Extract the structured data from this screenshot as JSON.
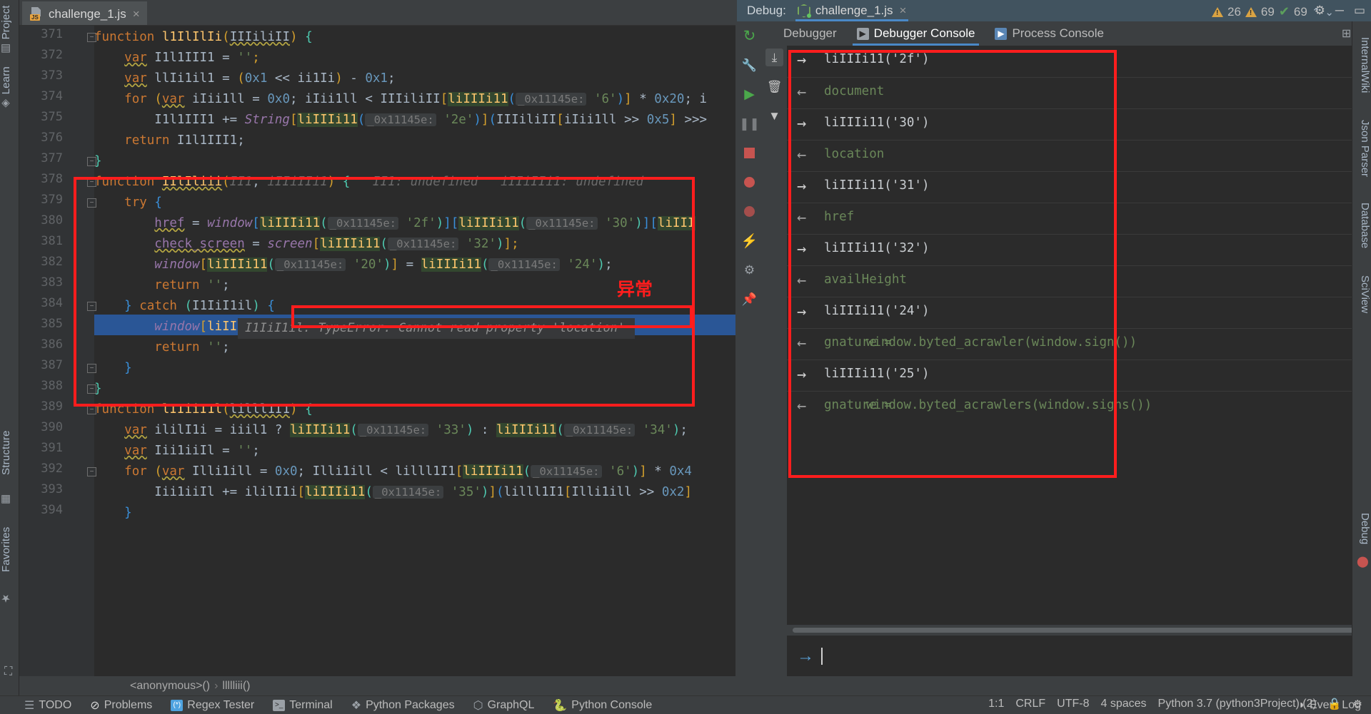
{
  "window": {
    "editor_tab": {
      "label": "challenge_1.js",
      "icon": "js-file-icon",
      "close": "×"
    },
    "debug_title": "Debug:",
    "debug_session_tab": "challenge_1.js",
    "debug_close": "×",
    "settings_icon": "gear-icon",
    "minimize_icon": "–",
    "hide_icon": "—"
  },
  "left_strip": [
    {
      "label": "Project",
      "icon": "project-icon"
    },
    {
      "label": "Learn",
      "icon": "learn-icon"
    },
    {
      "label": "Structure",
      "icon": "structure-icon"
    },
    {
      "label": "Favorites",
      "icon": "star-icon"
    }
  ],
  "right_strip": [
    {
      "label": "InternalWiki",
      "icon": "wiki-icon"
    },
    {
      "label": "Json Parser",
      "icon": "json-icon"
    },
    {
      "label": "Database",
      "icon": "database-icon"
    },
    {
      "label": "SciView",
      "icon": "sciview-icon"
    },
    {
      "label": "Debug",
      "icon": "debug-icon"
    }
  ],
  "inspection": {
    "warnings_major": "26",
    "warnings_minor": "69",
    "checks": "69",
    "up_icon": "chevron-up-icon",
    "down_icon": "chevron-down-icon"
  },
  "editor": {
    "first_line": 371,
    "current_exec_line": 385,
    "lines": [
      {
        "n": 371,
        "html": "<span class=\"kw\">function</span> <span class=\"fn\">l1IlIlIi</span><span class=\"brk1\">(</span><span class=\"wavy\">IIIiliII</span><span class=\"brk1\">)</span> <span class=\"brk3\">{</span>"
      },
      {
        "n": 372,
        "html": "    <span class=\"kw wavy\">var</span> I1l1III1 = <span class=\"str\">''</span><span class=\"brk1\">;</span>"
      },
      {
        "n": 373,
        "html": "    <span class=\"kw wavy\">var</span> llIi1il1 = <span class=\"brk1\">(</span><span class=\"num\">0x1</span> &lt;&lt; ii1Ii<span class=\"brk1\">)</span> - <span class=\"num\">0x1</span>;"
      },
      {
        "n": 374,
        "html": "    <span class=\"kw\">for</span> <span class=\"brk1\">(</span><span class=\"kw wavy\">var</span> iIii1ll = <span class=\"num\">0x0</span>; iIii1ll &lt; IIIiliII<span class=\"brk1\">[</span><span class=\"hl\"><span class=\"fn\">liIIIi11</span></span><span class=\"brk2\">(</span><span class=\"inlay\">_0x11145e:</span> <span class=\"str\">'6'</span><span class=\"brk2\">)</span><span class=\"brk1\">]</span> * <span class=\"num\">0x20</span>; i"
      },
      {
        "n": 375,
        "html": "        I1l1III1 += <span class=\"italic-pur\">String</span><span class=\"brk1\">[</span><span class=\"hl\"><span class=\"fn\">liIIIi11</span></span><span class=\"brk2\">(</span><span class=\"inlay\">_0x11145e:</span> <span class=\"str\">'2e'</span><span class=\"brk2\">)</span><span class=\"brk1\">]</span><span class=\"brk2\">(</span>IIIiliII<span class=\"brk1\">[</span>iIii1ll &gt;&gt; <span class=\"num\">0x5</span><span class=\"brk1\">]</span> &gt;&gt;&gt;"
      },
      {
        "n": 376,
        "html": "    <span class=\"kw\">return</span> I1l1III1;"
      },
      {
        "n": 377,
        "html": "<span class=\"brk3\">}</span>"
      },
      {
        "n": 378,
        "html": "<span class=\"kw\">function</span> <span class=\"fn wavy\">IIlIliii</span><span class=\"brk1\">(</span><span class=\"hint\">II1</span>, <span class=\"hint\">iIIiIIi1</span><span class=\"brk1\">)</span> <span class=\"brk3\">{</span>   <span class=\"hint\">II1: undefined   iIIiIIi1: undefined</span>"
      },
      {
        "n": 379,
        "html": "    <span class=\"kw\">try</span> <span class=\"brk2\">{</span>"
      },
      {
        "n": 380,
        "html": "        <span class=\"fld wavy\">href</span> = <span class=\"italic-pur\">window</span><span class=\"brk2\">[</span><span class=\"hl\"><span class=\"fn\">liIIIi11</span></span><span class=\"brk3\">(</span><span class=\"inlay\">_0x11145e:</span> <span class=\"str\">'2f'</span><span class=\"brk3\">)</span><span class=\"brk2\">]</span><span class=\"brk2\">[</span><span class=\"hl\"><span class=\"fn\">liIIIi11</span></span><span class=\"brk3\">(</span><span class=\"inlay\">_0x11145e:</span> <span class=\"str\">'30'</span><span class=\"brk3\">)</span><span class=\"brk2\">]</span><span class=\"brk2\">[</span><span class=\"hl\"><span class=\"fn\">liIII</span></span>"
      },
      {
        "n": 381,
        "html": "        <span class=\"fld wavy\">check_screen</span> = <span class=\"italic-pur\">screen</span><span class=\"brk1\">[</span><span class=\"hl\"><span class=\"fn\">liIIIi11</span></span><span class=\"brk3\">(</span><span class=\"inlay\">_0x11145e:</span> <span class=\"str\">'32'</span><span class=\"brk3\">)</span><span class=\"brk1\">]</span><span class=\"brk1\">;</span>"
      },
      {
        "n": 382,
        "html": "        <span class=\"italic-pur\">window</span><span class=\"brk1\">[</span><span class=\"hl\"><span class=\"fn\">liIIIi11</span></span><span class=\"brk3\">(</span><span class=\"inlay\">_0x11145e:</span> <span class=\"str\">'20'</span><span class=\"brk3\">)</span><span class=\"brk1\">]</span> = <span class=\"hl\"><span class=\"fn\">liIIIi11</span></span><span class=\"brk3\">(</span><span class=\"inlay\">_0x11145e:</span> <span class=\"str\">'24'</span><span class=\"brk3\">)</span>;"
      },
      {
        "n": 383,
        "html": "        <span class=\"kw\">return</span> <span class=\"str\">''</span>;"
      },
      {
        "n": 384,
        "html": "    <span class=\"brk2\">}</span> <span class=\"kw\">catch</span> <span class=\"brk3\">(</span>I1IiI1il<span class=\"brk3\">)</span> <span class=\"brk2\">{</span>"
      },
      {
        "n": 385,
        "html": "        <span class=\"italic-pur\">window</span><span class=\"brk1\">[</span><span class=\"fn\">liIIIi11</span><span class=\"brk3\">(</span><span class=\"inlay\">_0x11145e:</span> <span class=\"str\">'20'</span><span class=\"brk3\">)</span><span class=\"brk1\">]</span> = <span class=\"fn\">liIIIi11</span><span class=\"brk3\">(</span><span class=\"inlay\">_0x11145e:</span> <span class=\"str\">'25'</span><span class=\"brk3\">)</span>;"
      },
      {
        "n": 386,
        "html": "        <span class=\"kw\">return</span> <span class=\"str\">''</span>;"
      },
      {
        "n": 387,
        "html": "    <span class=\"brk2\">}</span>"
      },
      {
        "n": 388,
        "html": "<span class=\"brk3\">}</span>"
      },
      {
        "n": 389,
        "html": "<span class=\"kw\">function</span> <span class=\"fn\">lIIiiI1l</span><span class=\"brk1\">(</span><span class=\"wavy\">lilll1I1</span><span class=\"brk1\">)</span> <span class=\"brk3\">{</span>"
      },
      {
        "n": 390,
        "html": "    <span class=\"kw wavy\">var</span> ililI1i = iiil1 ? <span class=\"hl\"><span class=\"fn\">liIIIi11</span></span><span class=\"brk3\">(</span><span class=\"inlay\">_0x11145e:</span> <span class=\"str\">'33'</span><span class=\"brk3\">)</span> : <span class=\"hl\"><span class=\"fn\">liIIIi11</span></span><span class=\"brk3\">(</span><span class=\"inlay\">_0x11145e:</span> <span class=\"str\">'34'</span><span class=\"brk3\">)</span>;"
      },
      {
        "n": 391,
        "html": "    <span class=\"kw wavy\">var</span> Iii1iiIl = <span class=\"str\">''</span>;"
      },
      {
        "n": 392,
        "html": "    <span class=\"kw\">for</span> <span class=\"brk1\">(</span><span class=\"kw wavy\">var</span> Illi1ill = <span class=\"num\">0x0</span>; Illi1ill &lt; lilll1I1<span class=\"brk1\">[</span><span class=\"hl\"><span class=\"fn\">liIIIi11</span></span><span class=\"brk3\">(</span><span class=\"inlay\">_0x11145e:</span> <span class=\"str\">'6'</span><span class=\"brk3\">)</span><span class=\"brk1\">]</span> * <span class=\"num\">0x4</span>"
      },
      {
        "n": 393,
        "html": "        Iii1iiIl += ililI1i<span class=\"brk1\">[</span><span class=\"hl\"><span class=\"fn\">liIIIi11</span></span><span class=\"brk3\">(</span><span class=\"inlay\">_0x11145e:</span> <span class=\"str\">'35'</span><span class=\"brk3\">)</span><span class=\"brk1\">]</span><span class=\"brk2\">(</span>lilll1I1<span class=\"brk1\">[</span>Illi1ill &gt;&gt; <span class=\"num\">0x2</span><span class=\"brk1\">]</span>"
      },
      {
        "n": 394,
        "html": "    <span class=\"brk2\">}</span>"
      }
    ],
    "error_tooltip": "I1IiI1il: TypeError: Cannot read property 'location'",
    "annotation_label": "异常"
  },
  "breadcrumb": {
    "item1": "<anonymous>()",
    "sep": "›",
    "item2": "llllliii()"
  },
  "debug_panel": {
    "tabs": [
      {
        "label": "Debugger",
        "icon": "",
        "active": false
      },
      {
        "label": "Debugger Console",
        "icon": "console-icon",
        "active": true
      },
      {
        "label": "Process Console",
        "icon": "process-icon",
        "active": false
      }
    ],
    "toolbar_left": [
      "rerun-icon",
      "play-icon",
      "pause-icon",
      "stop-icon",
      "breakpoints-icon",
      "mute-breakpoints-icon",
      "evaluate-icon",
      "settings-icon",
      "pin-icon"
    ],
    "toolbar_right": [
      "scroll-to-end-icon",
      "trash-icon",
      "filter-icon"
    ],
    "console_entries": [
      {
        "dir": "in",
        "text": "liIIIi11('2f')"
      },
      {
        "dir": "out",
        "text": "document"
      },
      {
        "dir": "in",
        "text": "liIIIi11('30')"
      },
      {
        "dir": "out",
        "text": "location"
      },
      {
        "dir": "in",
        "text": "liIIIi11('31')"
      },
      {
        "dir": "out",
        "text": "href"
      },
      {
        "dir": "in",
        "text": "liIIIi11('32')"
      },
      {
        "dir": "out",
        "text": "availHeight"
      },
      {
        "dir": "in",
        "text": "liIIIi11('24')"
      },
      {
        "dir": "out",
        "text": "gnature =",
        "text2": "window.byted_acrawler(window.sign())"
      },
      {
        "dir": "in",
        "text": "liIIIi11('25')"
      },
      {
        "dir": "out",
        "text": "gnature =",
        "text2": "window.byted_acrawlers(window.signs())"
      }
    ],
    "prompt_arrow": "→"
  },
  "bottom_toolbar": [
    {
      "label": "TODO",
      "icon": "list-icon"
    },
    {
      "label": "Problems",
      "icon": "error-icon"
    },
    {
      "label": "Regex Tester",
      "icon": "regex-icon"
    },
    {
      "label": "Terminal",
      "icon": "terminal-icon"
    },
    {
      "label": "Python Packages",
      "icon": "packages-icon"
    },
    {
      "label": "GraphQL",
      "icon": "graphql-icon"
    },
    {
      "label": "Python Console",
      "icon": "python-icon"
    }
  ],
  "bottom_toolbar_right": {
    "label": "Event Log",
    "icon": "event-log-icon"
  },
  "status_bar": {
    "caret": "1:1",
    "line_sep": "CRLF",
    "encoding": "UTF-8",
    "indent": "4 spaces",
    "interpreter": "Python 3.7 (python3Project) (2)",
    "lock_icon": "lock-icon",
    "inspect_icon": "inspection-icon"
  },
  "colors": {
    "accent": "#4a88c7",
    "annotation_red": "#ff1d1d",
    "selection_blue": "#2a5696",
    "console_green": "#6a8759"
  }
}
